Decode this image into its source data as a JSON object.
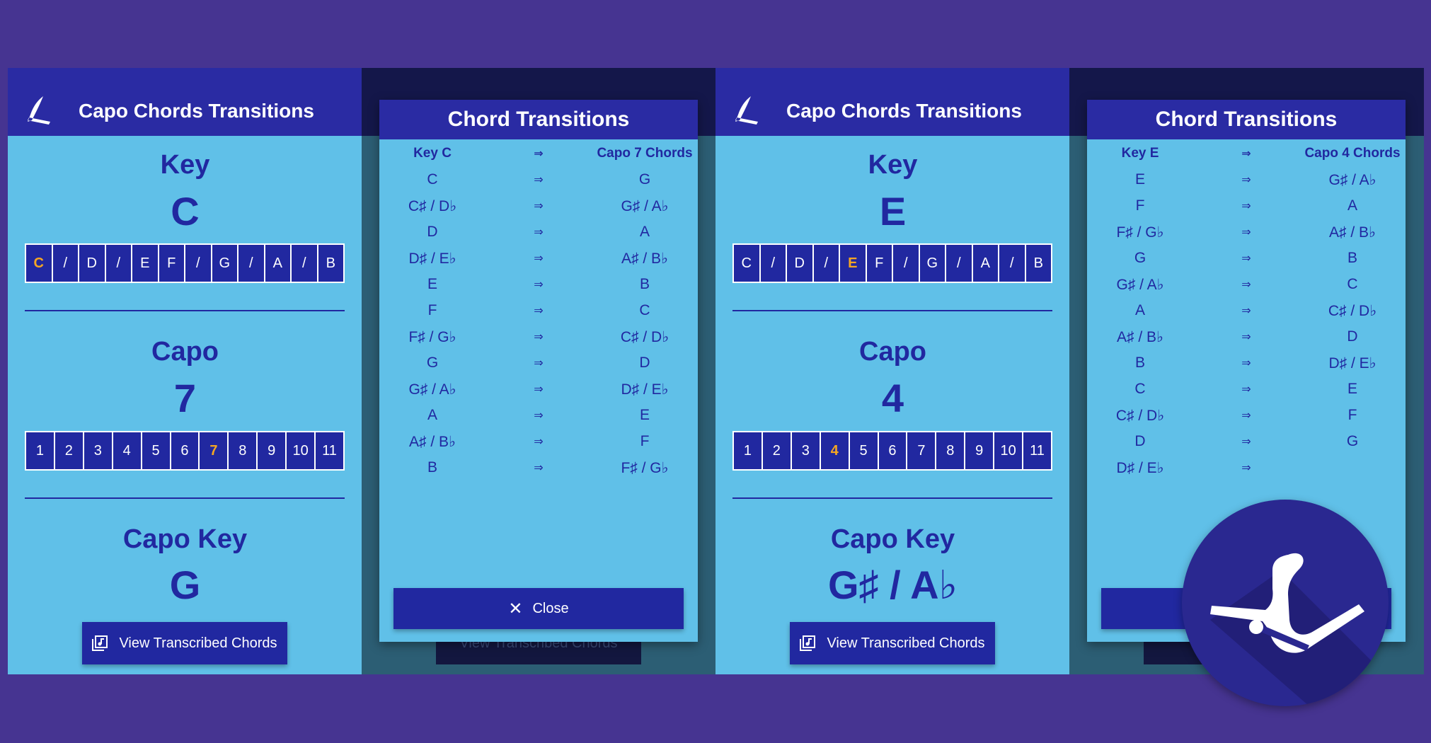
{
  "panel1": {
    "app_title": "Capo Chords Transitions",
    "key_label": "Key",
    "key_value": "C",
    "key_options": [
      "C",
      "/",
      "D",
      "/",
      "E",
      "F",
      "/",
      "G",
      "/",
      "A",
      "/",
      "B"
    ],
    "key_selected_index": 0,
    "capo_label": "Capo",
    "capo_value": "7",
    "capo_options": [
      "1",
      "2",
      "3",
      "4",
      "5",
      "6",
      "7",
      "8",
      "9",
      "10",
      "11"
    ],
    "capo_selected_index": 6,
    "capo_key_label": "Capo Key",
    "capo_key_value": "G",
    "view_button": "View Transcribed Chords"
  },
  "panel2": {
    "dialog_title": "Chord Transitions",
    "header": {
      "left": "Key C",
      "arrow": "⇒",
      "right": "Capo 7 Chords"
    },
    "rows": [
      {
        "left": "C",
        "arrow": "⇒",
        "right": "G"
      },
      {
        "left": "C♯ / D♭",
        "arrow": "⇒",
        "right": "G♯ / A♭"
      },
      {
        "left": "D",
        "arrow": "⇒",
        "right": "A"
      },
      {
        "left": "D♯ / E♭",
        "arrow": "⇒",
        "right": "A♯ / B♭"
      },
      {
        "left": "E",
        "arrow": "⇒",
        "right": "B"
      },
      {
        "left": "F",
        "arrow": "⇒",
        "right": "C"
      },
      {
        "left": "F♯ / G♭",
        "arrow": "⇒",
        "right": "C♯ / D♭"
      },
      {
        "left": "G",
        "arrow": "⇒",
        "right": "D"
      },
      {
        "left": "G♯ / A♭",
        "arrow": "⇒",
        "right": "D♯ / E♭"
      },
      {
        "left": "A",
        "arrow": "⇒",
        "right": "E"
      },
      {
        "left": "A♯ / B♭",
        "arrow": "⇒",
        "right": "F"
      },
      {
        "left": "B",
        "arrow": "⇒",
        "right": "F♯ / G♭"
      }
    ],
    "close_button": "Close",
    "background_button": "View Transcribed Chords"
  },
  "panel3": {
    "app_title": "Capo Chords Transitions",
    "key_label": "Key",
    "key_value": "E",
    "key_options": [
      "C",
      "/",
      "D",
      "/",
      "E",
      "F",
      "/",
      "G",
      "/",
      "A",
      "/",
      "B"
    ],
    "key_selected_index": 4,
    "capo_label": "Capo",
    "capo_value": "4",
    "capo_options": [
      "1",
      "2",
      "3",
      "4",
      "5",
      "6",
      "7",
      "8",
      "9",
      "10",
      "11"
    ],
    "capo_selected_index": 3,
    "capo_key_label": "Capo Key",
    "capo_key_value": "G♯ /  A♭",
    "view_button": "View Transcribed Chords"
  },
  "panel4": {
    "dialog_title": "Chord Transitions",
    "header": {
      "left": "Key E",
      "arrow": "⇒",
      "right": "Capo 4 Chords"
    },
    "rows": [
      {
        "left": "E",
        "arrow": "⇒",
        "right": "G♯ / A♭"
      },
      {
        "left": "F",
        "arrow": "⇒",
        "right": "A"
      },
      {
        "left": "F♯ / G♭",
        "arrow": "⇒",
        "right": "A♯ / B♭"
      },
      {
        "left": "G",
        "arrow": "⇒",
        "right": "B"
      },
      {
        "left": "G♯ / A♭",
        "arrow": "⇒",
        "right": "C"
      },
      {
        "left": "A",
        "arrow": "⇒",
        "right": "C♯ / D♭"
      },
      {
        "left": "A♯ / B♭",
        "arrow": "⇒",
        "right": "D"
      },
      {
        "left": "B",
        "arrow": "⇒",
        "right": "D♯ / E♭"
      },
      {
        "left": "C",
        "arrow": "⇒",
        "right": "E"
      },
      {
        "left": "C♯ / D♭",
        "arrow": "⇒",
        "right": "F"
      },
      {
        "left": "D",
        "arrow": "⇒",
        "right": "G"
      },
      {
        "left": "D♯ / E♭",
        "arrow": "⇒",
        "right": ""
      }
    ]
  },
  "colors": {
    "page_background": "#463491",
    "app_bar": "#2a2ba3",
    "content_background": "#60c0e8",
    "primary": "#2128a0",
    "selected_accent": "#f5a623"
  },
  "icons": {
    "app_logo": "capo-icon",
    "view_button_icon": "library-music-icon",
    "close_icon": "close-icon",
    "badge_logo": "capo-icon"
  }
}
